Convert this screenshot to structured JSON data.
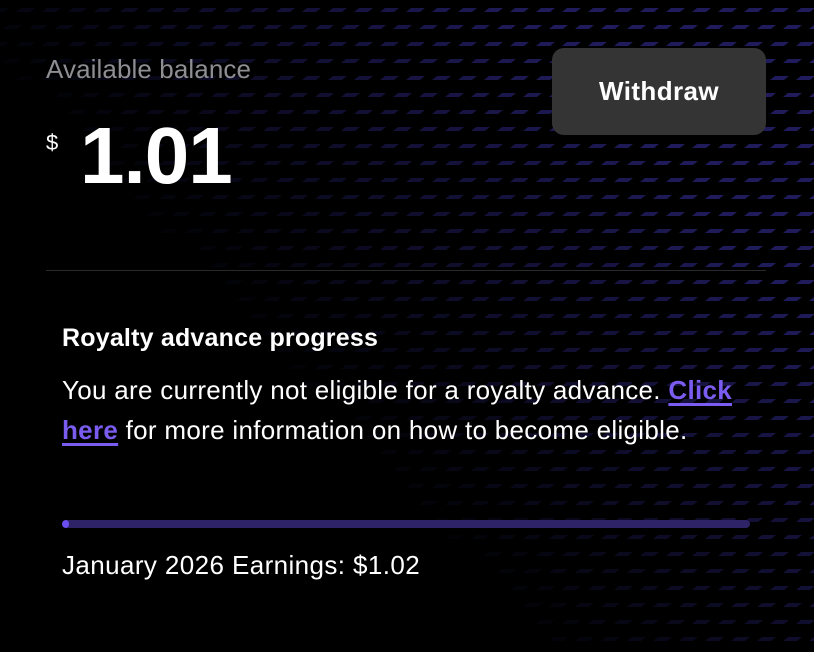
{
  "balance": {
    "label": "Available balance",
    "currency_symbol": "$",
    "amount": "1.01"
  },
  "actions": {
    "withdraw_label": "Withdraw"
  },
  "royalty": {
    "title": "Royalty advance progress",
    "status_text": "You are currently not eligible for a royalty advance.",
    "link_text": "Click here",
    "link_suffix": " for more information on how to become eligible.",
    "progress_fraction": 0.01,
    "earnings_text": "January 2026 Earnings: $1.02"
  },
  "colors": {
    "background": "#000000",
    "button_bg": "#343434",
    "accent": "#7b5cf0",
    "progress_track": "#2e2366",
    "progress_fill": "#6b4ef0",
    "muted_text": "#8e8e93"
  }
}
